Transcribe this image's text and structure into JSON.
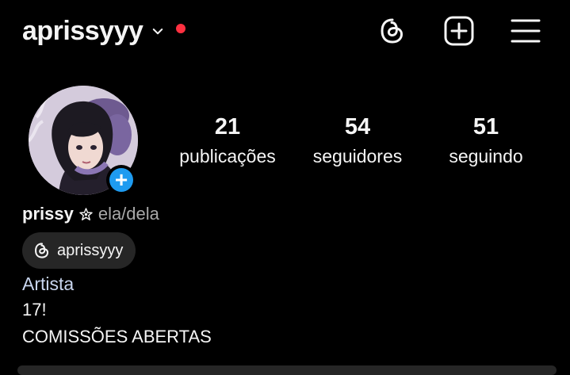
{
  "header": {
    "username": "aprissyyy",
    "icons": [
      "chevron-down-icon",
      "threads-icon",
      "new-post-icon",
      "menu-icon"
    ],
    "notification_dot_color": "#ff3040"
  },
  "profile": {
    "stats": [
      {
        "value": "21",
        "label": "publicações"
      },
      {
        "value": "54",
        "label": "seguidores"
      },
      {
        "value": "51",
        "label": "seguindo"
      }
    ],
    "name": "prissy",
    "pronouns": "ela/dela",
    "threads_handle": "aprissyyy",
    "category": "Artista",
    "bio_lines": [
      "17!",
      "COMISSÕES ABERTAS"
    ],
    "add_story_badge": "+",
    "accent_color": "#1e9bf0"
  }
}
